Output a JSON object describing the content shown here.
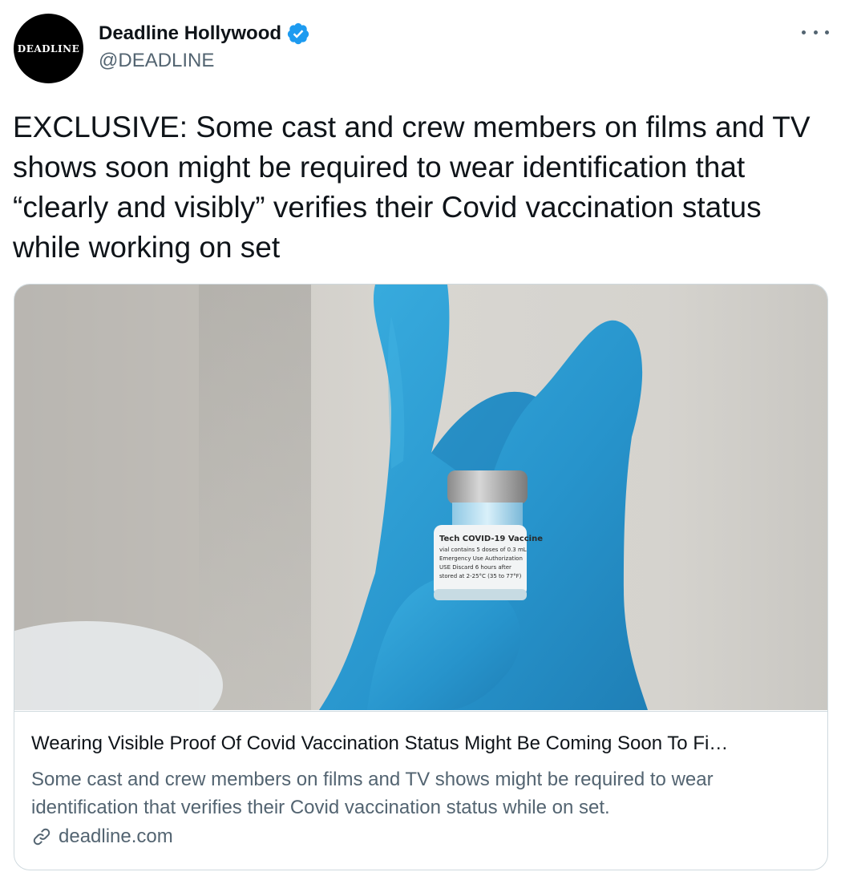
{
  "author": {
    "avatar_text": "DEADLINE",
    "display_name": "Deadline Hollywood",
    "handle": "@DEADLINE",
    "verified_icon": "verified-badge-icon",
    "verified_color": "#1d9bf0"
  },
  "menu": {
    "icon": "more-options-icon"
  },
  "tweet": {
    "text": "EXCLUSIVE: Some cast and crew members on films and TV shows soon might be required to wear identification that “clearly and visibly” verifies their Covid vaccination status while working on set"
  },
  "card": {
    "image_subject": "gloved-hand-holding-vaccine-vial",
    "vial_label_lines": [
      "Tech COVID-19 Vaccine",
      "vial contains 5 doses of 0.3 mL",
      "Emergency Use Authorization",
      "USE Discard 6 hours after",
      "stored at 2-25°C (35 to 77°F)"
    ],
    "title": "Wearing Visible Proof Of Covid Vaccination Status Might Be Coming Soon To Fi…",
    "description": "Some cast and crew members on films and TV shows might be required to wear identification that verifies their Covid vaccination status while on set.",
    "domain": "deadline.com",
    "link_icon": "link-icon"
  },
  "colors": {
    "text_primary": "#0f1419",
    "text_secondary": "#536471",
    "border": "#cfd9de",
    "glove": "#2f9fd6"
  }
}
